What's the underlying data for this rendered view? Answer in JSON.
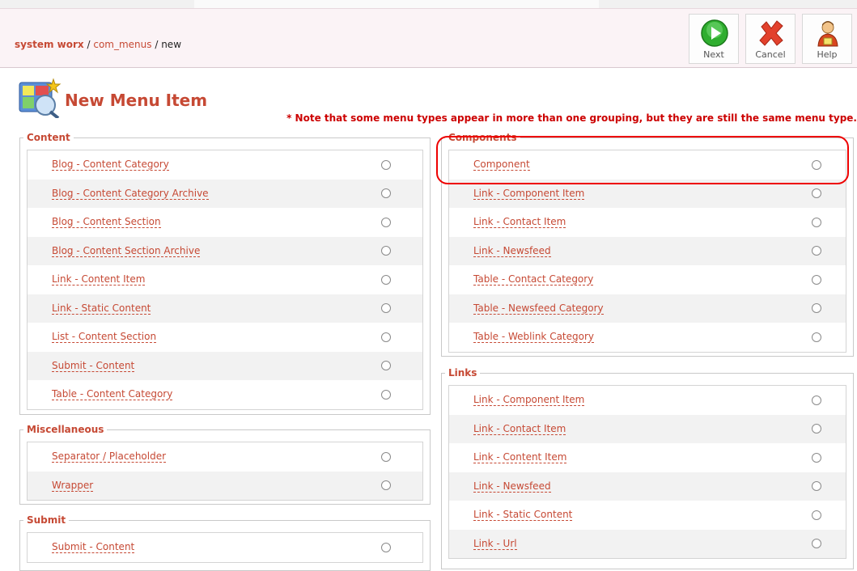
{
  "breadcrumb": {
    "site": "system worx",
    "component": "com_menus",
    "action": "new"
  },
  "toolbar": {
    "next": "Next",
    "cancel": "Cancel",
    "help": "Help"
  },
  "page_title": "New Menu Item",
  "note": "* Note that some menu types appear in more than one grouping, but they are still the same menu type.",
  "groups": {
    "content": {
      "legend": "Content",
      "items": [
        "Blog - Content Category",
        "Blog - Content Category Archive",
        "Blog - Content Section",
        "Blog - Content Section Archive",
        "Link - Content Item",
        "Link - Static Content",
        "List - Content Section",
        "Submit - Content",
        "Table - Content Category"
      ]
    },
    "miscellaneous": {
      "legend": "Miscellaneous",
      "items": [
        "Separator / Placeholder",
        "Wrapper"
      ]
    },
    "submit": {
      "legend": "Submit",
      "items": [
        "Submit - Content"
      ]
    },
    "components": {
      "legend": "Components",
      "items": [
        "Component",
        "Link - Component Item",
        "Link - Contact Item",
        "Link - Newsfeed",
        "Table - Contact Category",
        "Table - Newsfeed Category",
        "Table - Weblink Category"
      ]
    },
    "links": {
      "legend": "Links",
      "items": [
        "Link - Component Item",
        "Link - Contact Item",
        "Link - Content Item",
        "Link - Newsfeed",
        "Link - Static Content",
        "Link - Url"
      ]
    }
  },
  "colors": {
    "accent": "#c64934",
    "note": "#cc0000",
    "highlight": "#ee0000"
  }
}
